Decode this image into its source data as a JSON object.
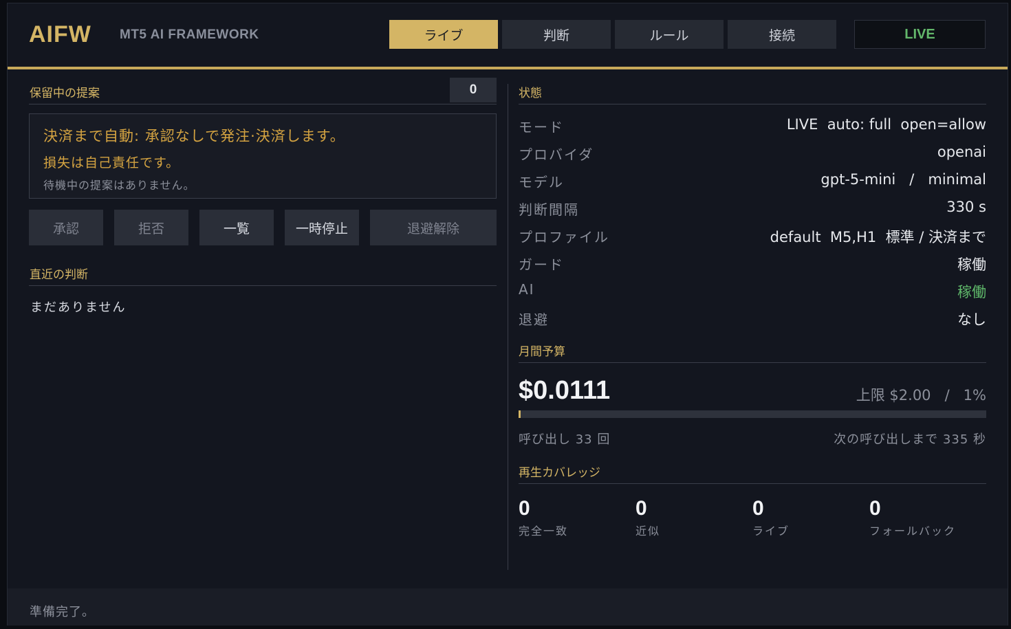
{
  "header": {
    "logo": "AIFW",
    "subtitle": "MT5 AI FRAMEWORK",
    "tabs": [
      {
        "label": "ライブ",
        "active": true
      },
      {
        "label": "判断"
      },
      {
        "label": "ルール"
      },
      {
        "label": "接続"
      }
    ],
    "live_badge": "LIVE"
  },
  "pending": {
    "title": "保留中の提案",
    "count": "0",
    "notice_line1": "決済まで自動: 承認なしで発注·決済します。",
    "notice_line2": "損失は自己責任です。",
    "notice_line3": "待機中の提案はありません。",
    "buttons": {
      "approve": "承認",
      "reject": "拒否",
      "list": "一覧",
      "pause": "一時停止",
      "unevacuate": "退避解除"
    }
  },
  "recent": {
    "title": "直近の判断",
    "empty": "まだありません"
  },
  "status": {
    "title": "状態",
    "rows": [
      {
        "label": "モード",
        "value": "LIVE  auto: full  open=allow"
      },
      {
        "label": "プロバイダ",
        "value": "openai"
      },
      {
        "label": "モデル",
        "value": "gpt-5-mini   /   minimal"
      },
      {
        "label": "判断間隔",
        "value": "330 s"
      },
      {
        "label": "プロファイル",
        "value": "default  M5,H1  標準 / 決済まで"
      },
      {
        "label": "ガード",
        "value": "稼働"
      },
      {
        "label": "AI",
        "value": "稼働"
      },
      {
        "label": "退避",
        "value": "なし"
      }
    ]
  },
  "budget": {
    "title": "月間予算",
    "amount": "$0.0111",
    "limit": "上限 $2.00   /   1%",
    "percent": 1,
    "calls": "呼び出し 33 回",
    "next_call": "次の呼び出しまで 335 秒"
  },
  "coverage": {
    "title": "再生カバレッジ",
    "items": [
      {
        "value": "0",
        "label": "完全一致"
      },
      {
        "value": "0",
        "label": "近似"
      },
      {
        "value": "0",
        "label": "ライブ"
      },
      {
        "value": "0",
        "label": "フォールバック"
      }
    ]
  },
  "footer": {
    "status": "準備完了。"
  },
  "colors": {
    "accent": "#d4b565",
    "live_green": "#63b86b",
    "warning": "#d4a341"
  }
}
